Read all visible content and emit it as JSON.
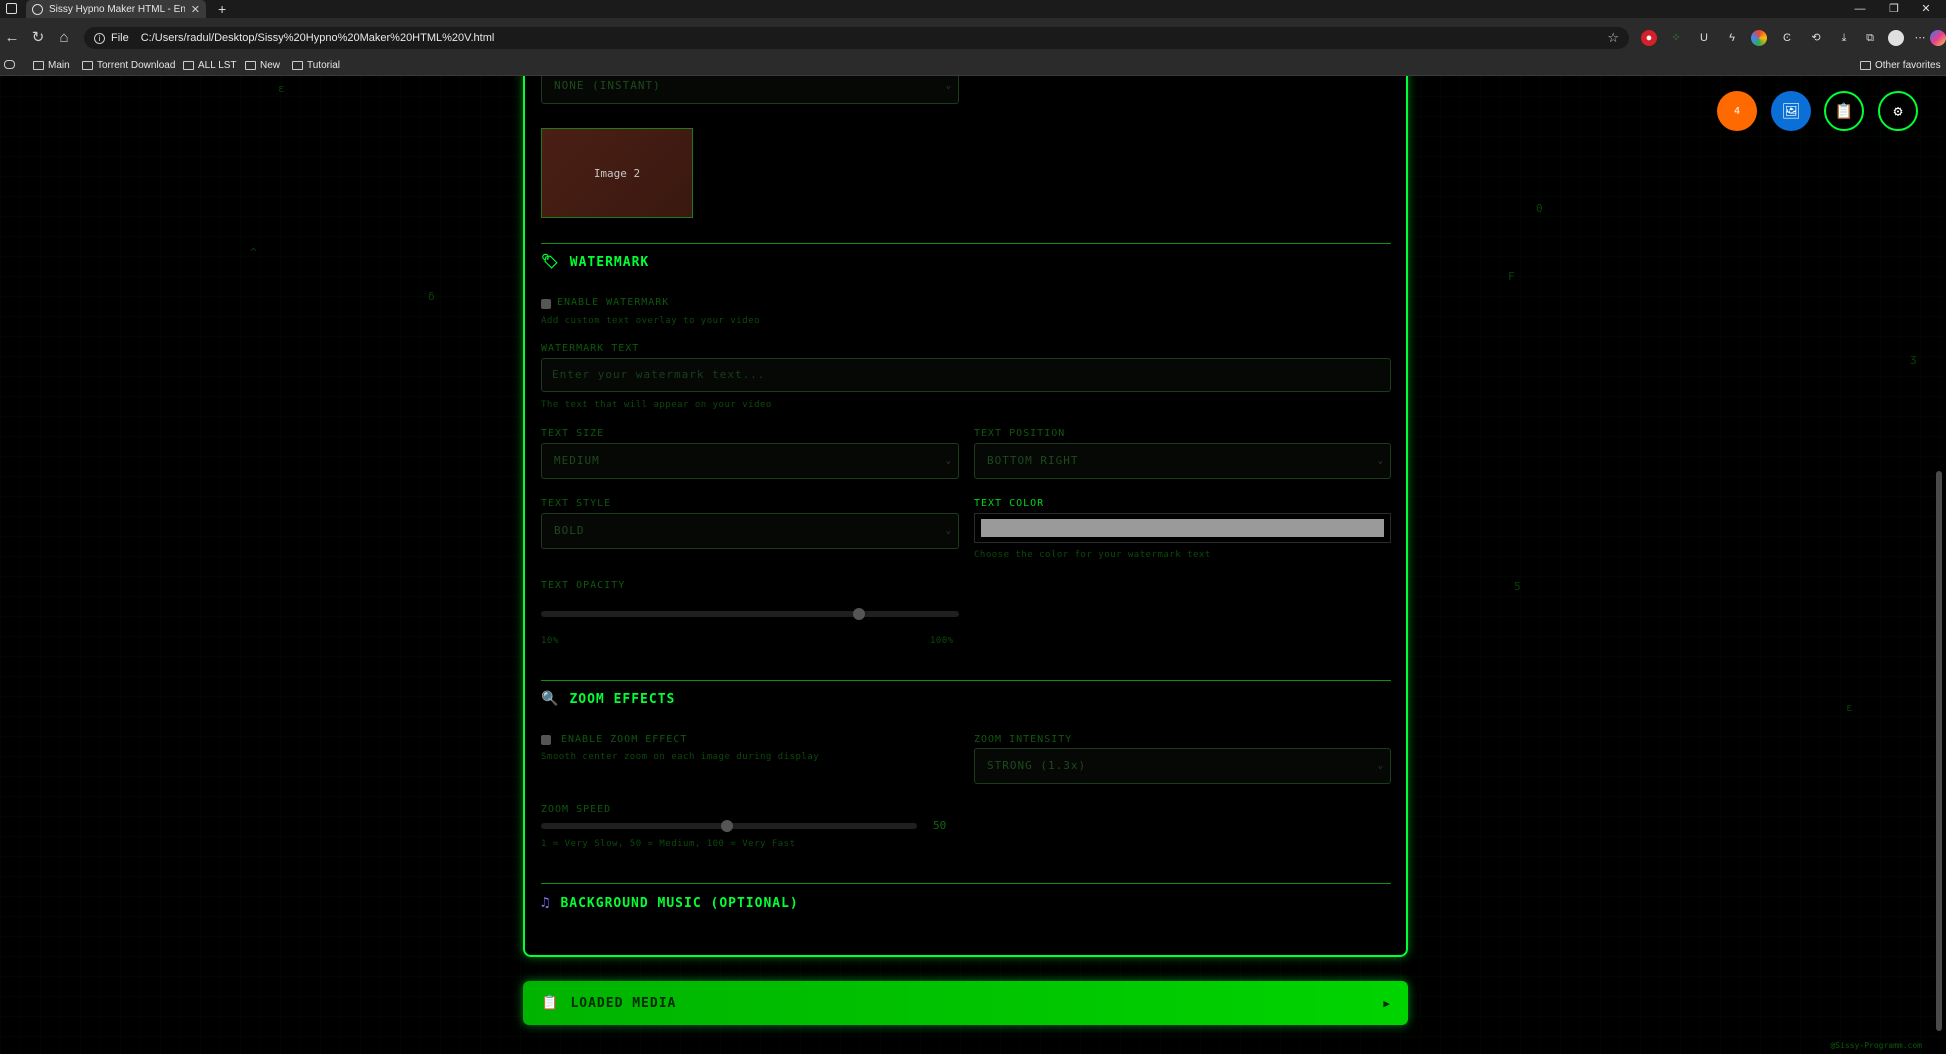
{
  "browser": {
    "tab_title": "Sissy Hypno Maker HTML - Enhan",
    "url_scheme": "File",
    "url": "C:/Users/radul/Desktop/Sissy%20Hypno%20Maker%20HTML%20V.html",
    "bookmarks": [
      "Main",
      "Torrent Download",
      "ALL LST",
      "New",
      "Tutorial"
    ],
    "other_favorites": "Other favorites"
  },
  "transition": {
    "selected": "NONE (INSTANT)",
    "thumb_label": "Image 2"
  },
  "watermark": {
    "title": "WATERMARK",
    "enable_label": "ENABLE WATERMARK",
    "enable_hint": "Add custom text overlay to your video",
    "text_label": "WATERMARK TEXT",
    "text_placeholder": "Enter your watermark text...",
    "text_hint": "The text that will appear on your video",
    "size_label": "TEXT SIZE",
    "size_value": "MEDIUM",
    "position_label": "TEXT POSITION",
    "position_value": "BOTTOM RIGHT",
    "style_label": "TEXT STYLE",
    "style_value": "BOLD",
    "color_label": "TEXT COLOR",
    "color_value": "#9a9a9a",
    "color_hint": "Choose the color for your watermark text",
    "opacity_label": "TEXT OPACITY",
    "opacity_min": "10%",
    "opacity_max": "100%",
    "opacity_value": 0.76
  },
  "zoom": {
    "title": "ZOOM EFFECTS",
    "enable_label": "ENABLE ZOOM EFFECT",
    "enable_hint": "Smooth center zoom on each image during display",
    "intensity_label": "ZOOM INTENSITY",
    "intensity_value": "STRONG (1.3x)",
    "speed_label": "ZOOM SPEED",
    "speed_value": "50",
    "speed_hint": "1 = Very Slow, 50 = Medium, 100 = Very Fast"
  },
  "music": {
    "title": "BACKGROUND MUSIC (OPTIONAL)"
  },
  "loaded_media": {
    "label": "LOADED MEDIA"
  },
  "fab": {
    "badge": "4"
  },
  "footer": "@Sissy-Programm.com",
  "colors": {
    "accent": "#00ff33",
    "fab_orange": "#ff6a00",
    "fab_blue": "#0a6fd6"
  }
}
